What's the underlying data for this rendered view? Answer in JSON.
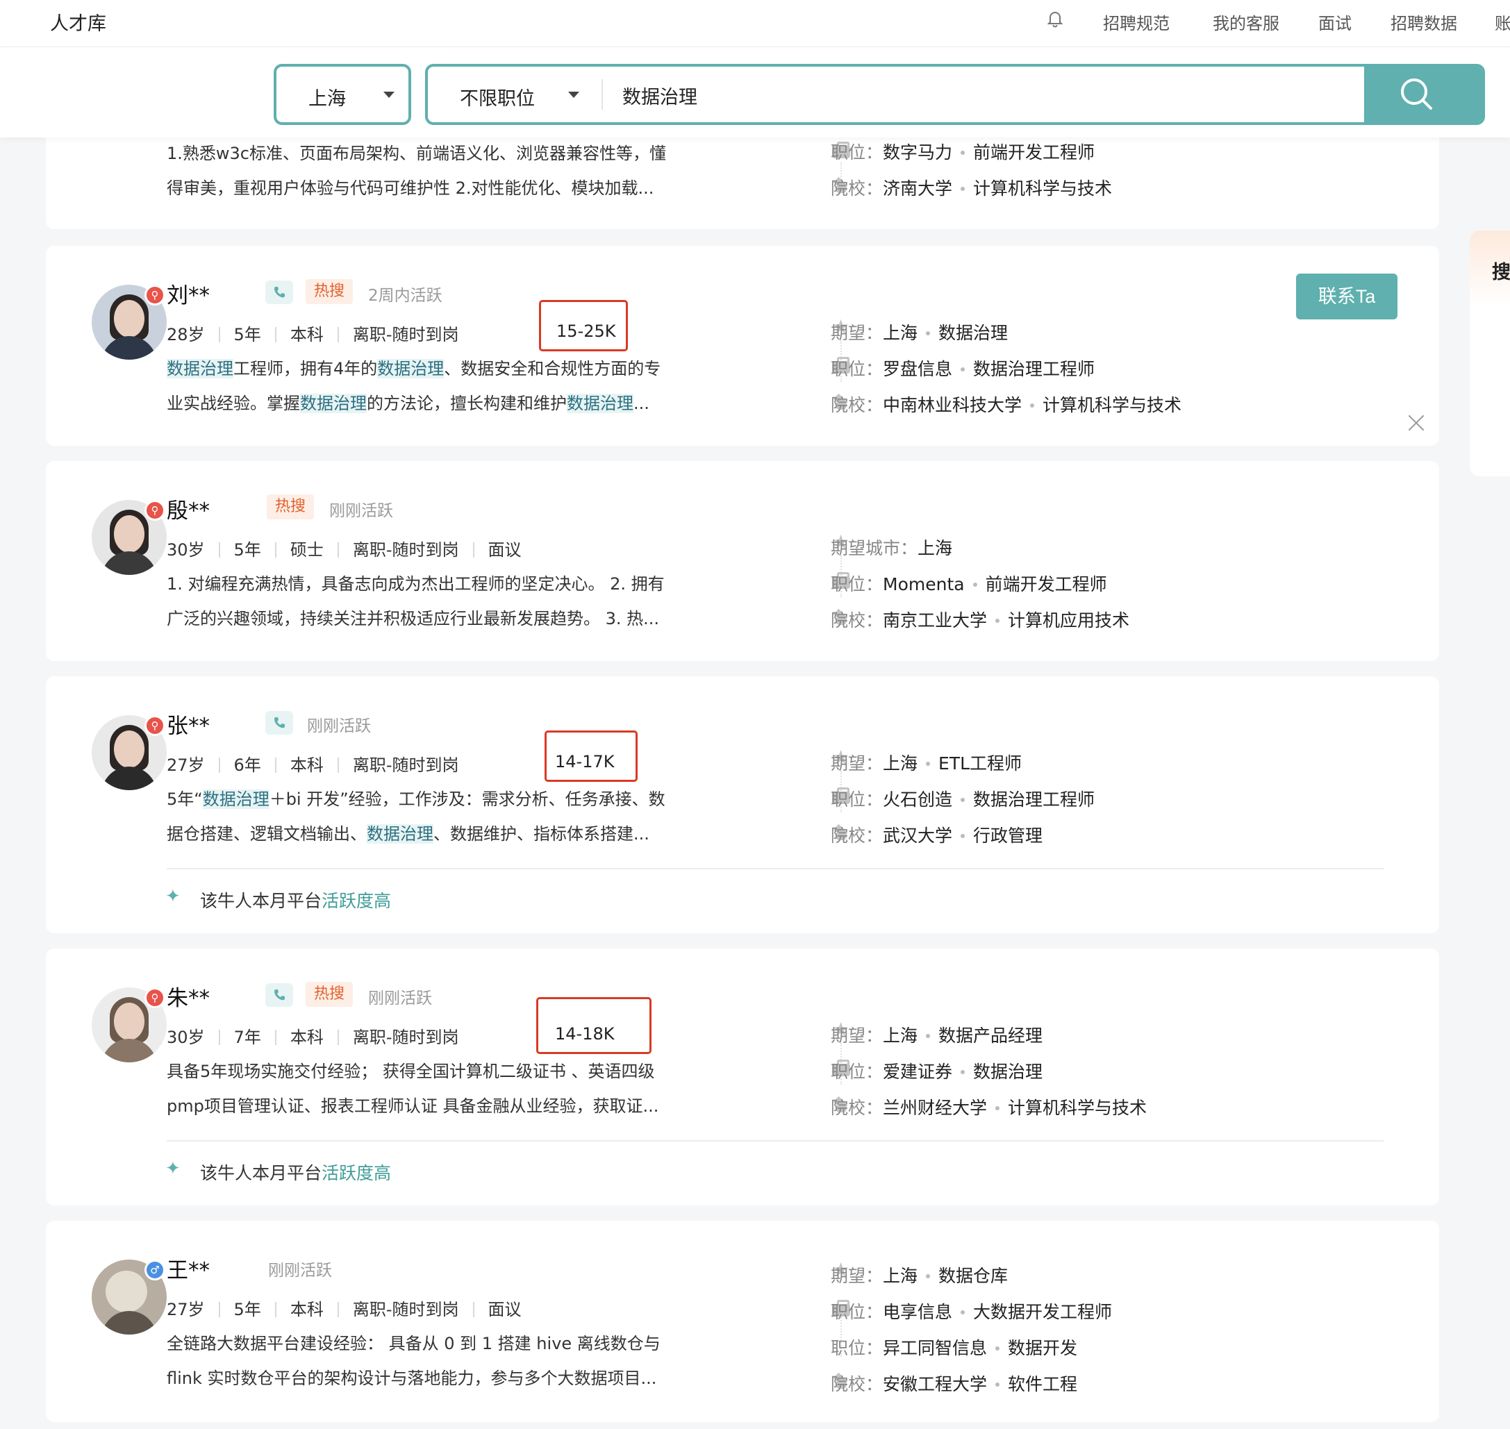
{
  "nav": {
    "brand": "人才库",
    "links": [
      "招聘规范",
      "我的客服",
      "面试",
      "招聘数据",
      "账"
    ]
  },
  "search": {
    "city": "上海",
    "job": "不限职位",
    "query": "数据治理"
  },
  "side_panel": {
    "label": "搜"
  },
  "contact_button": "联系Ta",
  "cards": [
    {
      "desc_line1": "1.熟悉w3c标准、页面布局架构、前端语义化、浏览器兼容性等，懂",
      "desc_line2": "得审美，重视用户体验与代码可维护性 2.对性能优化、模块加载...",
      "rows": [
        {
          "k": "职位：",
          "a": "数字马力",
          "b": "前端开发工程师"
        },
        {
          "k": "院校：",
          "a": "济南大学",
          "b": "计算机科学与技术"
        }
      ]
    },
    {
      "name": "刘**",
      "hot": "热搜",
      "active": "2周内活跃",
      "age": "28岁",
      "exp": "5年",
      "edu": "本科",
      "status": "离职-随时到岗",
      "salary": "15-25K",
      "rows": [
        {
          "k": "期望：",
          "a": "上海",
          "b": "数据治理"
        },
        {
          "k": "职位：",
          "a": "罗盘信息",
          "b": "数据治理工程师"
        },
        {
          "k": "院校：",
          "a": "中南林业科技大学",
          "b": "计算机科学与技术"
        }
      ]
    },
    {
      "name": "殷**",
      "hot": "热搜",
      "active": "刚刚活跃",
      "age": "30岁",
      "exp": "5年",
      "edu": "硕士",
      "status": "离职-随时到岗",
      "salary": "面议",
      "desc_line1": "1. 对编程充满热情，具备志向成为杰出工程师的坚定决心。 2. 拥有",
      "desc_line2": "广泛的兴趣领域，持续关注并积极适应行业最新发展趋势。 3. 热...",
      "rows": [
        {
          "k": "期望城市：",
          "a": "上海",
          "b": ""
        },
        {
          "k": "职位：",
          "a": "Momenta",
          "b": "前端开发工程师"
        },
        {
          "k": "院校：",
          "a": "南京工业大学",
          "b": "计算机应用技术"
        }
      ]
    },
    {
      "name": "张**",
      "active": "刚刚活跃",
      "age": "27岁",
      "exp": "6年",
      "edu": "本科",
      "status": "离职-随时到岗",
      "salary": "14-17K",
      "note_prefix": "该牛人本月平台",
      "note_hl": "活跃度高",
      "rows": [
        {
          "k": "期望：",
          "a": "上海",
          "b": "ETL工程师"
        },
        {
          "k": "职位：",
          "a": "火石创造",
          "b": "数据治理工程师"
        },
        {
          "k": "院校：",
          "a": "武汉大学",
          "b": "行政管理"
        }
      ]
    },
    {
      "name": "朱**",
      "hot": "热搜",
      "active": "刚刚活跃",
      "age": "30岁",
      "exp": "7年",
      "edu": "本科",
      "status": "离职-随时到岗",
      "salary": "14-18K",
      "desc_line1": "具备5年现场实施交付经验； 获得全国计算机二级证书 、英语四级",
      "desc_line2": "pmp项目管理认证、报表工程师认证 具备金融从业经验，获取证...",
      "note_prefix": "该牛人本月平台",
      "note_hl": "活跃度高",
      "rows": [
        {
          "k": "期望：",
          "a": "上海",
          "b": "数据产品经理"
        },
        {
          "k": "职位：",
          "a": "爱建证券",
          "b": "数据治理"
        },
        {
          "k": "院校：",
          "a": "兰州财经大学",
          "b": "计算机科学与技术"
        }
      ]
    },
    {
      "name": "王**",
      "active": "刚刚活跃",
      "age": "27岁",
      "exp": "5年",
      "edu": "本科",
      "status": "离职-随时到岗",
      "salary": "面议",
      "desc_line1": "全链路大数据平台建设经验： 具备从 0 到 1 搭建 hive 离线数仓与",
      "desc_line2": "flink 实时数仓平台的架构设计与落地能力，参与多个大数据项目...",
      "rows": [
        {
          "k": "期望：",
          "a": "上海",
          "b": "数据仓库"
        },
        {
          "k": "职位：",
          "a": "电享信息",
          "b": "大数据开发工程师"
        },
        {
          "k": "职位：",
          "a": "异工同智信息",
          "b": "数据开发"
        },
        {
          "k": "院校：",
          "a": "安徽工程大学",
          "b": "软件工程"
        }
      ]
    }
  ]
}
